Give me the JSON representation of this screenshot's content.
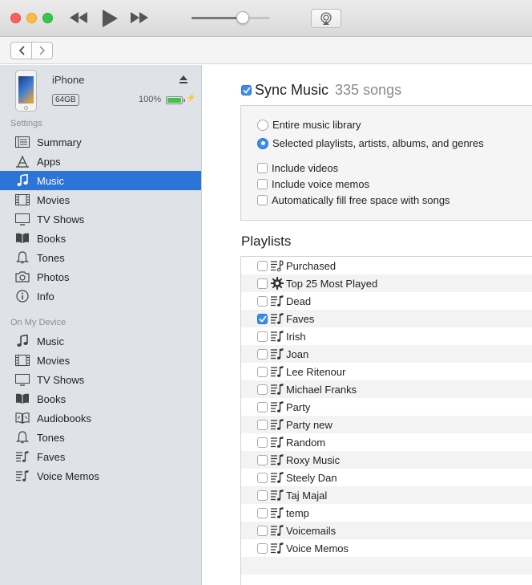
{
  "window": {
    "traffic_lights": [
      "close",
      "minimize",
      "zoom"
    ]
  },
  "toolbar": {
    "volume": 0.65
  },
  "device": {
    "name": "iPhone",
    "capacity": "64GB",
    "battery": "100%",
    "battery_level": 1.0
  },
  "sidebar": {
    "settings_title": "Settings",
    "settings": [
      {
        "label": "Summary",
        "icon": "summary-icon",
        "active": false
      },
      {
        "label": "Apps",
        "icon": "apps-icon",
        "active": false
      },
      {
        "label": "Music",
        "icon": "music-note-icon",
        "active": true
      },
      {
        "label": "Movies",
        "icon": "film-icon",
        "active": false
      },
      {
        "label": "TV Shows",
        "icon": "tv-icon",
        "active": false
      },
      {
        "label": "Books",
        "icon": "book-icon",
        "active": false
      },
      {
        "label": "Tones",
        "icon": "bell-icon",
        "active": false
      },
      {
        "label": "Photos",
        "icon": "camera-icon",
        "active": false
      },
      {
        "label": "Info",
        "icon": "info-icon",
        "active": false
      }
    ],
    "device_title": "On My Device",
    "device_items": [
      {
        "label": "Music",
        "icon": "music-note-icon"
      },
      {
        "label": "Movies",
        "icon": "film-icon"
      },
      {
        "label": "TV Shows",
        "icon": "tv-icon"
      },
      {
        "label": "Books",
        "icon": "book-icon"
      },
      {
        "label": "Audiobooks",
        "icon": "audiobook-icon"
      },
      {
        "label": "Tones",
        "icon": "bell-icon"
      },
      {
        "label": "Faves",
        "icon": "playlist-icon"
      },
      {
        "label": "Voice Memos",
        "icon": "playlist-icon"
      }
    ]
  },
  "sync": {
    "title": "Sync Music",
    "count": "335 songs",
    "checked": true
  },
  "options": {
    "radio": [
      {
        "label": "Entire music library",
        "checked": false
      },
      {
        "label": "Selected playlists, artists, albums, and genres",
        "checked": true
      }
    ],
    "checkboxes": [
      {
        "label": "Include videos",
        "checked": false
      },
      {
        "label": "Include voice memos",
        "checked": false
      },
      {
        "label": "Automatically fill free space with songs",
        "checked": false
      }
    ]
  },
  "playlists": {
    "title": "Playlists",
    "items": [
      {
        "label": "Purchased",
        "checked": false,
        "icon": "purchased-playlist-icon"
      },
      {
        "label": "Top 25 Most Played",
        "checked": false,
        "icon": "gear-icon"
      },
      {
        "label": "Dead",
        "checked": false,
        "icon": "playlist-icon"
      },
      {
        "label": "Faves",
        "checked": true,
        "icon": "playlist-icon"
      },
      {
        "label": "Irish",
        "checked": false,
        "icon": "playlist-icon"
      },
      {
        "label": "Joan",
        "checked": false,
        "icon": "playlist-icon"
      },
      {
        "label": "Lee Ritenour",
        "checked": false,
        "icon": "playlist-icon"
      },
      {
        "label": "Michael Franks",
        "checked": false,
        "icon": "playlist-icon"
      },
      {
        "label": "Party",
        "checked": false,
        "icon": "playlist-icon"
      },
      {
        "label": "Party new",
        "checked": false,
        "icon": "playlist-icon"
      },
      {
        "label": "Random",
        "checked": false,
        "icon": "playlist-icon"
      },
      {
        "label": "Roxy Music",
        "checked": false,
        "icon": "playlist-icon"
      },
      {
        "label": "Steely Dan",
        "checked": false,
        "icon": "playlist-icon"
      },
      {
        "label": "Taj Majal",
        "checked": false,
        "icon": "playlist-icon"
      },
      {
        "label": "temp",
        "checked": false,
        "icon": "playlist-icon"
      },
      {
        "label": "Voicemails",
        "checked": false,
        "icon": "playlist-icon"
      },
      {
        "label": "Voice Memos",
        "checked": false,
        "icon": "playlist-icon"
      }
    ]
  },
  "colors": {
    "accent": "#2d74d9",
    "checkbox": "#3a8bf5",
    "battery": "#3dc64a"
  }
}
